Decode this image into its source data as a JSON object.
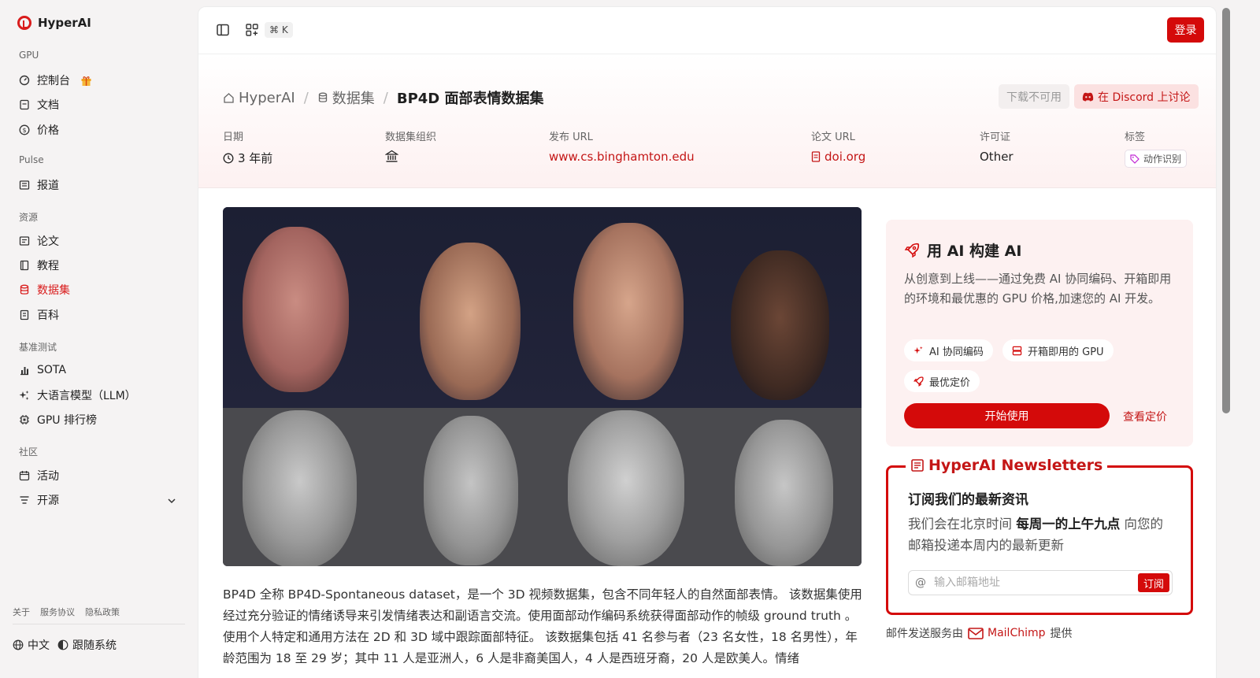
{
  "app": {
    "name": "HyperAI"
  },
  "sidebar": {
    "groups": [
      {
        "label": "GPU",
        "items": [
          {
            "label": "控制台",
            "icon": "gauge-icon"
          },
          {
            "label": "文档",
            "icon": "doc-icon"
          },
          {
            "label": "价格",
            "icon": "dollar-icon"
          }
        ]
      },
      {
        "label": "Pulse",
        "items": [
          {
            "label": "报道",
            "icon": "newspaper-icon"
          }
        ]
      },
      {
        "label": "资源",
        "items": [
          {
            "label": "论文",
            "icon": "paper-icon"
          },
          {
            "label": "教程",
            "icon": "book-icon"
          },
          {
            "label": "数据集",
            "icon": "database-icon",
            "active": true
          },
          {
            "label": "百科",
            "icon": "wiki-icon"
          }
        ]
      },
      {
        "label": "基准测试",
        "items": [
          {
            "label": "SOTA",
            "icon": "bar-chart-icon"
          },
          {
            "label": "大语言模型（LLM）",
            "icon": "sparkle-icon"
          },
          {
            "label": "GPU 排行榜",
            "icon": "chip-icon"
          }
        ]
      },
      {
        "label": "社区",
        "items": [
          {
            "label": "活动",
            "icon": "calendar-icon"
          },
          {
            "label": "开源",
            "icon": "list-icon"
          }
        ]
      }
    ],
    "footer_links": [
      "关于",
      "服务协议",
      "隐私政策"
    ],
    "language": "中文",
    "theme": "跟随系统"
  },
  "topbar": {
    "shortcut": "⌘ K",
    "login_label": "登录"
  },
  "header": {
    "breadcrumbs": [
      "HyperAI",
      "数据集",
      "BP4D 面部表情数据集"
    ],
    "download_label": "下载不可用",
    "discord_label": "在 Discord 上讨论",
    "meta": {
      "date_label": "日期",
      "date_value": "3 年前",
      "org_label": "数据集组织",
      "url_label": "发布 URL",
      "url_value": "www.cs.binghamton.edu",
      "paper_label": "论文 URL",
      "paper_value": "doi.org",
      "license_label": "许可证",
      "license_value": "Other",
      "tags_label": "标签",
      "tag_value": "动作识别"
    }
  },
  "description": "BP4D 全称 BP4D-Spontaneous dataset，是一个 3D 视频数据集，包含不同年轻人的自然面部表情。 该数据集使用经过充分验证的情绪诱导来引发情绪表达和副语言交流。使用面部动作编码系统获得面部动作的帧级 ground truth 。使用个人特定和通用方法在 2D 和 3D 域中跟踪面部特征。 该数据集包括 41 名参与者（23 名女性，18 名男性），年龄范围为 18 至 29 岁；其中 11 人是亚洲人，6 人是非裔美国人，4 人是西班牙裔，20 人是欧美人。情绪",
  "promo": {
    "title": "用 AI 构建 AI",
    "text": "从创意到上线——通过免费 AI 协同编码、开箱即用的环境和最优惠的 GPU 价格,加速您的 AI 开发。",
    "chips": [
      "AI 协同编码",
      "开箱即用的 GPU",
      "最优定价"
    ],
    "start_label": "开始使用",
    "pricing_label": "查看定价"
  },
  "newsletter": {
    "title": "HyperAI Newsletters",
    "heading": "订阅我们的最新资讯",
    "text_before": "我们会在北京时间 ",
    "text_bold": "每周一的上午九点",
    "text_after": " 向您的邮箱投递本周内的最新更新",
    "placeholder": "输入邮箱地址",
    "subscribe_label": "订阅",
    "footer_prefix": "邮件发送服务由",
    "footer_provider": "MailChimp",
    "footer_suffix": "提供"
  },
  "colors": {
    "accent": "#d40a0a",
    "link": "#c41616"
  }
}
